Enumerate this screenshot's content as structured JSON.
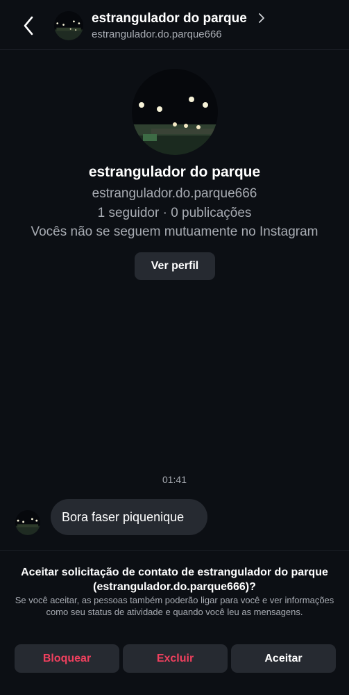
{
  "header": {
    "name": "estrangulador do parque",
    "handle": "estrangulador.do.parque666"
  },
  "profile": {
    "name": "estrangulador do parque",
    "handle": "estrangulador.do.parque666",
    "stats": "1 seguidor · 0 publicações",
    "mutual": "Vocês não se seguem mutuamente no Instagram",
    "view_profile_label": "Ver perfil"
  },
  "conversation": {
    "timestamp": "01:41",
    "messages": [
      {
        "text": "Bora faser piquenique"
      }
    ]
  },
  "request": {
    "title": "Aceitar solicitação de contato de estrangulador do parque (estrangulador.do.parque666)?",
    "description": "Se você aceitar, as pessoas também poderão ligar para você e ver informações como seu status de atividade e quando você leu as mensagens.",
    "block_label": "Bloquear",
    "delete_label": "Excluir",
    "accept_label": "Aceitar"
  },
  "colors": {
    "background": "#0c0f14",
    "surface": "#262a31",
    "danger": "#f0405e",
    "secondary_text": "#a8acb3"
  },
  "icons": {
    "back": "chevron-left-icon",
    "open": "chevron-right-icon"
  }
}
